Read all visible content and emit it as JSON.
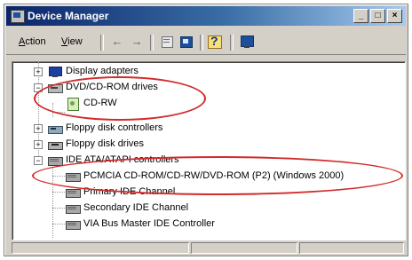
{
  "window": {
    "title": "Device Manager"
  },
  "title_buttons": {
    "minimize": "_",
    "maximize": "□",
    "close": "×"
  },
  "menu": [
    {
      "label": "Action",
      "underline": "A",
      "rest": "ction"
    },
    {
      "label": "View",
      "underline": "V",
      "rest": "iew"
    }
  ],
  "toolbar": {
    "back_glyph": "←",
    "forward_glyph": "→",
    "icons": [
      "back-arrow-icon",
      "forward-arrow-icon",
      "properties-icon",
      "refresh-icon",
      "help-icon",
      "monitor-icon"
    ]
  },
  "tree": {
    "items": [
      {
        "label": "Display adapters",
        "level": 0,
        "expander": "+",
        "icon": "display-adapter-icon"
      },
      {
        "label": "DVD/CD-ROM drives",
        "level": 0,
        "expander": "−",
        "icon": "dvd-drive-icon"
      },
      {
        "label": "CD-RW",
        "level": 1,
        "expander": "",
        "icon": "cd-rw-icon"
      },
      {
        "label": "Floppy disk controllers",
        "level": 0,
        "expander": "+",
        "icon": "floppy-controller-icon"
      },
      {
        "label": "Floppy disk drives",
        "level": 0,
        "expander": "+",
        "icon": "floppy-drive-icon"
      },
      {
        "label": "IDE ATA/ATAPI controllers",
        "level": 0,
        "expander": "−",
        "icon": "ide-controller-icon"
      },
      {
        "label": "PCMCIA CD-ROM/CD-RW/DVD-ROM (P2) (Windows 2000)",
        "level": 1,
        "expander": "",
        "icon": "ide-channel-icon"
      },
      {
        "label": "Primary IDE Channel",
        "level": 1,
        "expander": "",
        "icon": "ide-channel-icon"
      },
      {
        "label": "Secondary IDE Channel",
        "level": 1,
        "expander": "",
        "icon": "ide-channel-icon"
      },
      {
        "label": "VIA Bus Master IDE Controller",
        "level": 1,
        "expander": "",
        "icon": "ide-channel-icon"
      }
    ]
  },
  "annotations": {
    "highlight_color": "#d32a2a"
  },
  "colors": {
    "titlebar_start": "#0a246a",
    "titlebar_end": "#a6caf0",
    "window_face": "#d4d0c8"
  }
}
